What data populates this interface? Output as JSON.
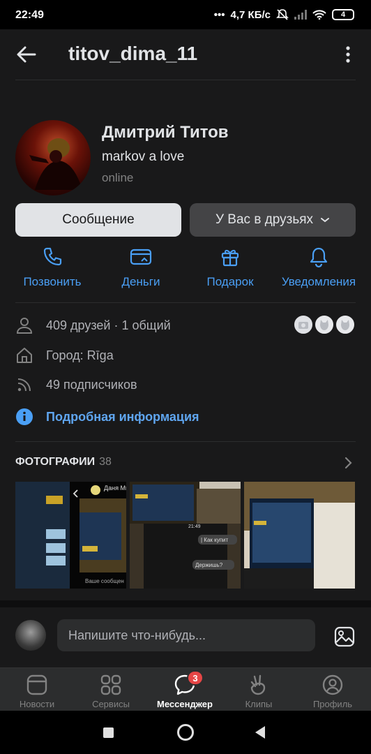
{
  "status_bar": {
    "time": "22:49",
    "network_speed": "4,7 КБ/с",
    "battery": "4"
  },
  "header": {
    "title": "titov_dima_11"
  },
  "profile": {
    "name": "Дмитрий Титов",
    "status": "markov a love",
    "online": "online"
  },
  "buttons": {
    "message": "Сообщение",
    "friends": "У Вас в друзьях"
  },
  "actions": [
    {
      "label": "Позвонить",
      "icon": "phone-icon"
    },
    {
      "label": "Деньги",
      "icon": "money-card-icon"
    },
    {
      "label": "Подарок",
      "icon": "gift-icon"
    },
    {
      "label": "Уведомления",
      "icon": "bell-icon"
    }
  ],
  "info": {
    "friends": "409 друзей · 1 общий",
    "city": "Город: Rīga",
    "followers": "49 подписчиков",
    "details": "Подробная информация"
  },
  "photos": {
    "title": "ФОТОГРАФИИ",
    "count": "38"
  },
  "photo_text": {
    "chat_name": "Даня Мы",
    "input_hint": "Ваше сообщен",
    "bubble1": "| Как купит",
    "bubble2": "Держишь?",
    "time": "21:49"
  },
  "comment": {
    "placeholder": "Напишите что-нибудь..."
  },
  "tabs": [
    {
      "label": "Новости",
      "icon": "news-icon"
    },
    {
      "label": "Сервисы",
      "icon": "services-icon"
    },
    {
      "label": "Мессенджер",
      "icon": "messenger-icon",
      "badge": "3",
      "active": true
    },
    {
      "label": "Клипы",
      "icon": "clips-icon"
    },
    {
      "label": "Профиль",
      "icon": "profile-icon"
    }
  ],
  "colors": {
    "accent": "#4a9ff5",
    "background": "#19191a",
    "badge": "#e64646"
  }
}
